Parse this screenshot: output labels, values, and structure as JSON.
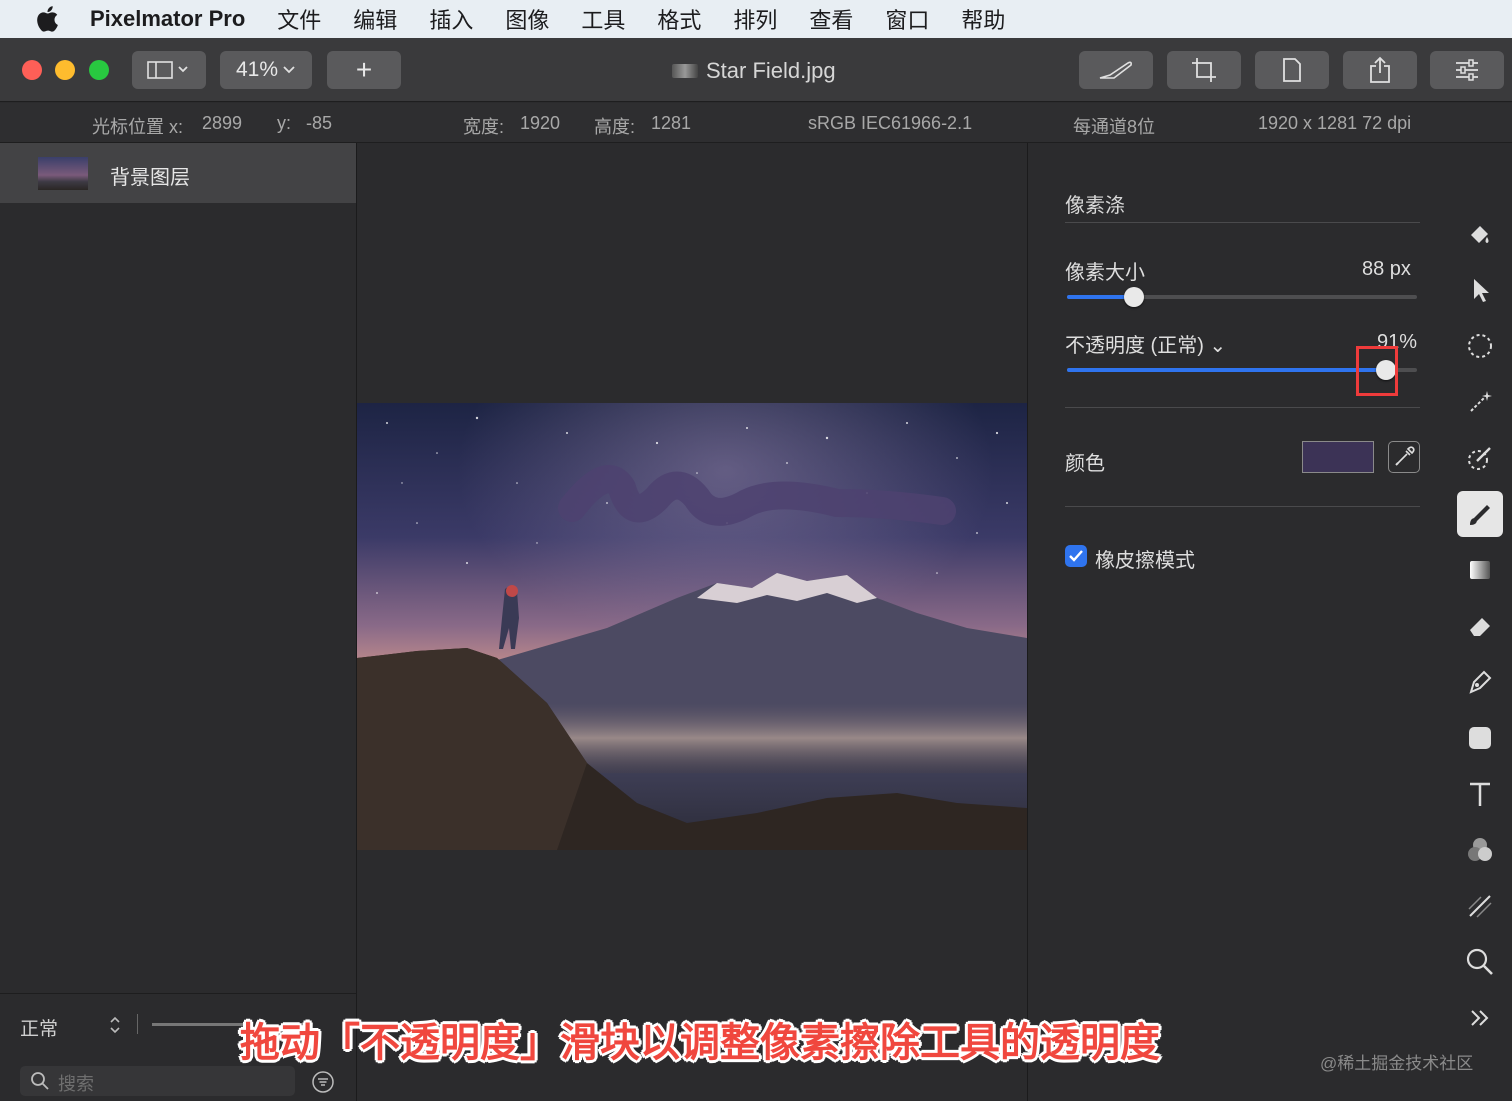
{
  "menubar": {
    "app_name": "Pixelmator Pro",
    "items": [
      "文件",
      "编辑",
      "插入",
      "图像",
      "工具",
      "格式",
      "排列",
      "查看",
      "窗口",
      "帮助"
    ]
  },
  "toolbar": {
    "zoom": "41%",
    "add_label": "+",
    "doc_title": "Star Field.jpg"
  },
  "infobar": {
    "cursor_label": "光标位置 x:",
    "cursor_x": "2899",
    "cursor_y_label": "y:",
    "cursor_y": "-85",
    "width_label": "宽度:",
    "width": "1920",
    "height_label": "高度:",
    "height": "1281",
    "color_profile": "sRGB IEC61966-2.1",
    "bit_depth": "每通道8位",
    "resolution": "1920 x 1281 72 dpi"
  },
  "layers": {
    "items": [
      {
        "name": "背景图层"
      }
    ],
    "blend_mode": "正常",
    "search_placeholder": "搜索"
  },
  "tool_options": {
    "title": "像素涤",
    "size_label": "像素大小",
    "size_value": "88 px",
    "size_fraction": 0.19,
    "opacity_label": "不透明度 (正常) ⌄",
    "opacity_value": "91%",
    "opacity_fraction": 0.91,
    "color_label": "颜色",
    "color_value": "#3c3356",
    "eraser_mode_label": "橡皮擦模式",
    "eraser_mode_checked": true
  },
  "tools": [
    "paint-bucket-icon",
    "arrow-icon",
    "selection-icon",
    "magic-wand-icon",
    "quick-select-icon",
    "brush-icon",
    "gradient-icon",
    "eraser-icon",
    "pen-icon",
    "shape-icon",
    "text-icon",
    "color-adjust-icon",
    "retouch-icon",
    "zoom-icon",
    "more-icon"
  ],
  "caption": "拖动「不透明度」滑块以调整像素擦除工具的透明度",
  "watermark": "@稀土掘金技术社区"
}
